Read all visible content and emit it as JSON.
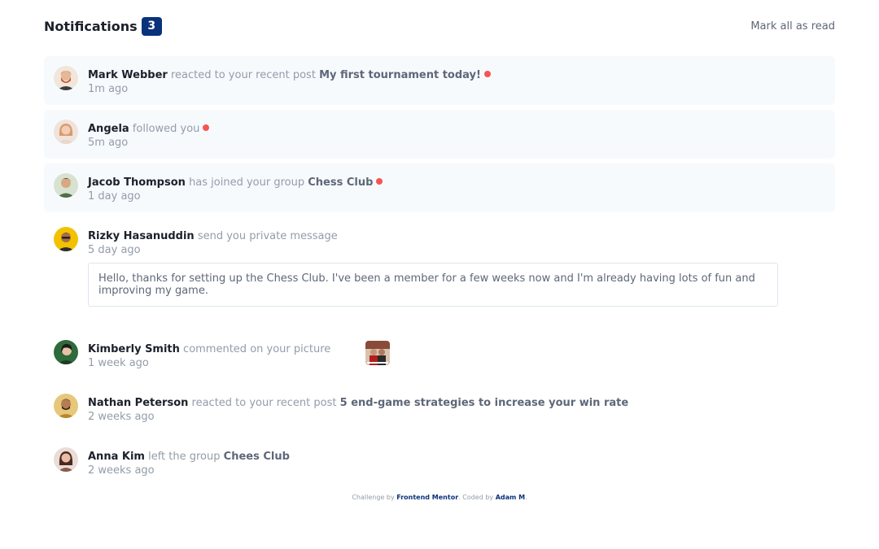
{
  "header": {
    "title": "Notifications",
    "count": "3",
    "mark_all": "Mark all as read"
  },
  "notifications": [
    {
      "name": "Mark Webber",
      "action": "reacted to your recent post",
      "target": "My first tournament today!",
      "time": "1m ago",
      "unread": true,
      "avatar_color": "#c8552d"
    },
    {
      "name": "Angela",
      "action": "followed you",
      "target": "",
      "time": "5m ago",
      "unread": true,
      "avatar_color": "#e0b49b"
    },
    {
      "name": "Jacob Thompson",
      "action": "has joined your group",
      "target": "Chess Club",
      "time": "1 day ago",
      "unread": true,
      "avatar_color": "#4f6e4a"
    },
    {
      "name": "Rizky Hasanuddin",
      "action": "send you private message",
      "target": "",
      "time": "5 day ago",
      "unread": false,
      "avatar_color": "#e6b800",
      "message": "Hello, thanks for setting up the Chess Club. I've been a member for a few weeks now and I'm already having lots of fun and improving my game."
    },
    {
      "name": "Kimberly Smith",
      "action": "commented on your picture",
      "target": "",
      "time": "1 week ago",
      "unread": false,
      "avatar_color": "#2e6a3a"
    },
    {
      "name": "Nathan Peterson",
      "action": "reacted to your recent post",
      "target": "5 end-game strategies to increase your win rate",
      "time": "2 weeks ago",
      "unread": false,
      "avatar_color": "#b8872c"
    },
    {
      "name": "Anna Kim",
      "action": "left the group",
      "target": "Chees Club",
      "time": "2 weeks ago",
      "unread": false,
      "avatar_color": "#8a5a4a"
    }
  ],
  "footer": {
    "prefix": "Challenge by",
    "brand": "Frontend Mentor",
    "middle": ". Coded by",
    "author": "Adam M",
    "suffix": "."
  },
  "colors": {
    "accent": "#0a327b",
    "unread_bg": "#f7fafd",
    "unread_dot": "#f65552",
    "muted": "#939caa"
  }
}
